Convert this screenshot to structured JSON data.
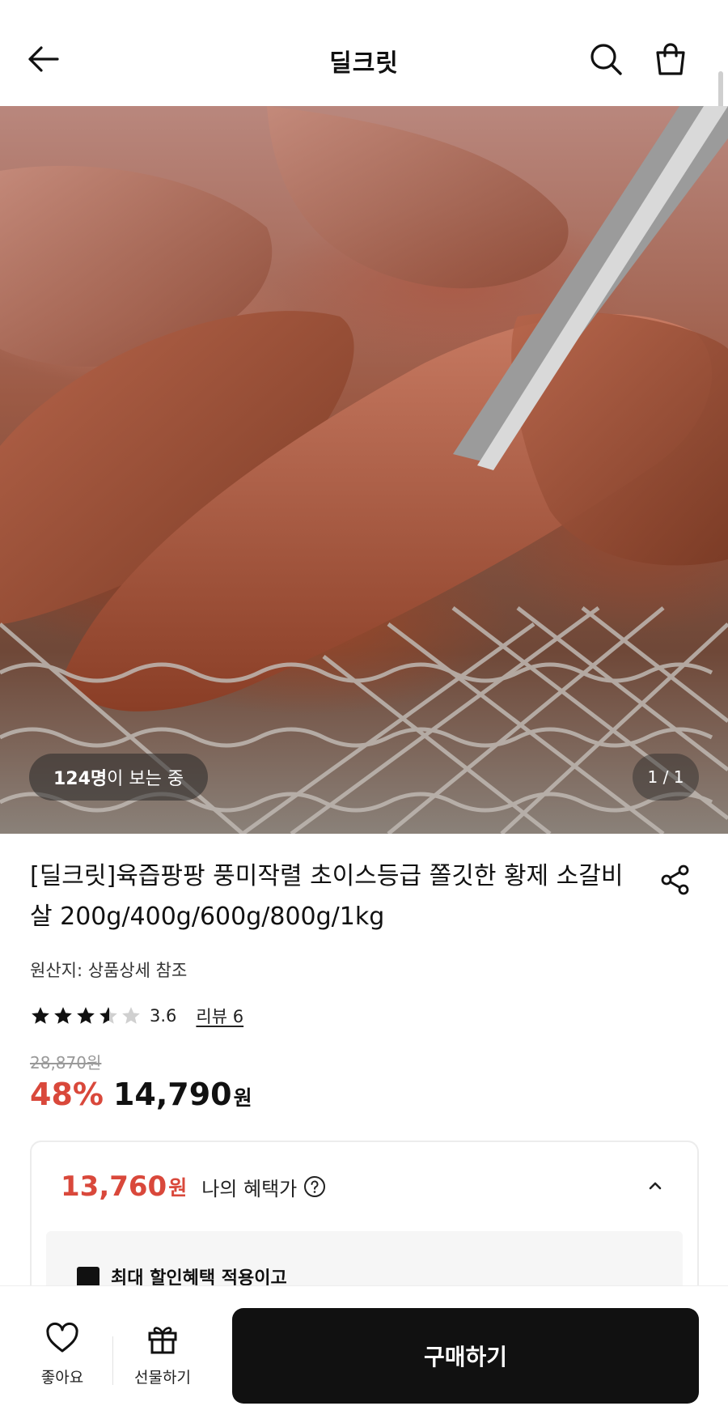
{
  "header": {
    "title": "딜크릿",
    "icons": {
      "back": "back-arrow-icon",
      "search": "search-icon",
      "cart": "shopping-bag-icon"
    }
  },
  "hero": {
    "viewer_count": "124명",
    "viewer_suffix": "이 보는 중",
    "page_indicator": "1 / 1"
  },
  "product": {
    "title": "[딜크릿]육즙팡팡 풍미작렬 초이스등급 쫄깃한 황제 소갈비살 200g/400g/600g/800g/1kg",
    "origin": "원산지: 상품상세 참조",
    "rating": 3.6,
    "rating_text": "3.6",
    "review_link": "리뷰 6",
    "original_price": "28,870원",
    "discount": "48%",
    "sale_price": "14,790",
    "currency": "원"
  },
  "benefit": {
    "price": "13,760",
    "currency": "원",
    "label": "나의 혜택가",
    "inner_text": "최대 할인혜택 적용이고"
  },
  "bottom_bar": {
    "like_label": "좋아요",
    "gift_label": "선물하기",
    "buy_label": "구매하기"
  },
  "colors": {
    "accent_red": "#d9483b",
    "primary_button": "#111111",
    "muted_text": "#999999"
  }
}
